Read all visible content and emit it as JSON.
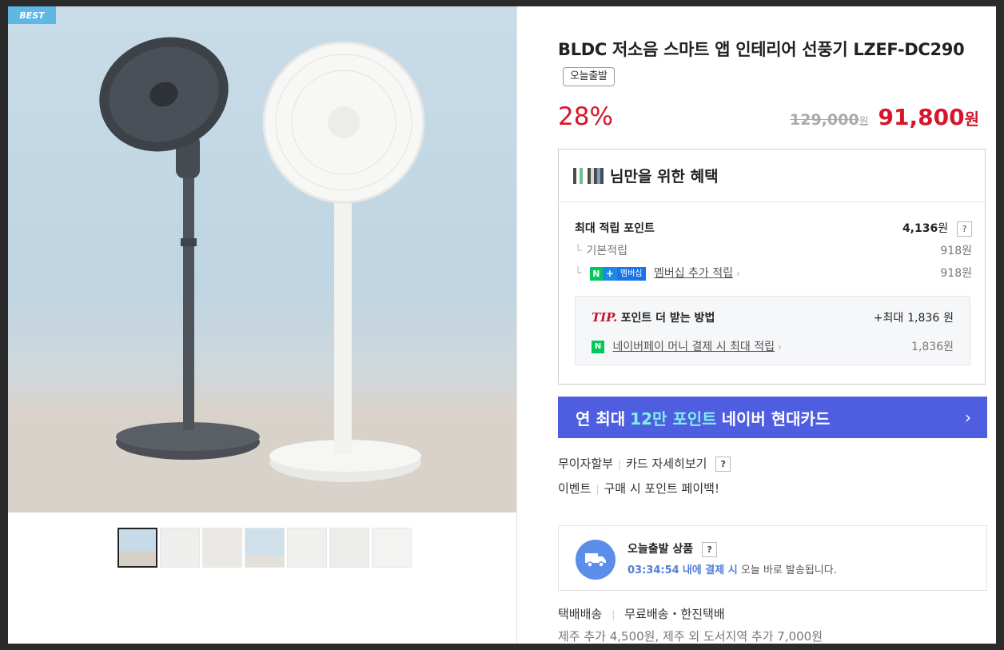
{
  "gallery": {
    "badge": "BEST",
    "thumbnail_count": 7
  },
  "product": {
    "title": "BLDC 저소음 스마트 앱 인테리어 선풍기 LZEF-DC290",
    "tag": "오늘출발",
    "discount": "28%",
    "original_price": "129,000",
    "original_currency": "원",
    "sale_price": "91,800",
    "sale_currency": "원"
  },
  "benefit": {
    "heading": "님만을 위한 혜택",
    "max_points_label": "최대 적립 포인트",
    "max_points_value": "4,136",
    "max_points_unit": "원",
    "help": "?",
    "basic_label": "기본적립",
    "basic_value": "918원",
    "membership_badge_n": "N",
    "membership_badge_plus": "+",
    "membership_badge_text": "멤버십",
    "membership_label": "멤버십 추가 적립",
    "membership_value": "918원",
    "tip_word": "TIP.",
    "tip_label": "포인트 더 받는 방법",
    "tip_value_prefix": "+최대",
    "tip_value": "1,836",
    "tip_unit": "원",
    "npay_icon": "N",
    "npay_label": "네이버페이 머니 결제 시 최대 적립",
    "npay_value": "1,836원"
  },
  "card_banner": {
    "prefix": "연 최대",
    "highlight": "12만 포인트",
    "suffix": "네이버 현대카드",
    "arrow": "›"
  },
  "links": {
    "installment": "무이자할부",
    "card_detail": "카드 자세히보기",
    "help": "?",
    "event": "이벤트",
    "event_desc": "구매 시 포인트 페이백!"
  },
  "shipping": {
    "title": "오늘출발 상품",
    "help": "?",
    "time": "03:34:54",
    "time_suffix": "내에 결제 시",
    "desc": "오늘 바로 발송됩니다."
  },
  "delivery": {
    "method": "택배배송",
    "info": "무료배송・한진택배",
    "extra": "제주 추가 4,500원, 제주 외 도서지역 추가 7,000원"
  },
  "colors": {
    "accent_red": "#d6162b",
    "banner_blue": "#4f5ee0",
    "banner_highlight": "#7ff0e6",
    "npay_green": "#03c75a"
  }
}
